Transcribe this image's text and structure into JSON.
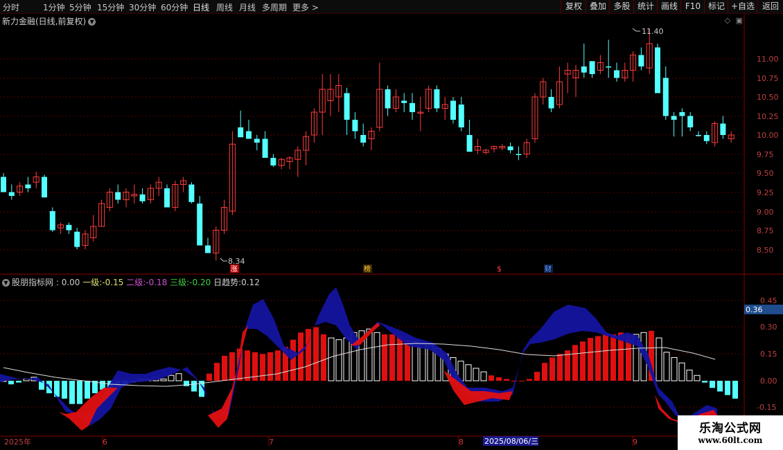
{
  "toolbar": {
    "tabs": [
      "分时",
      "1分钟",
      "5分钟",
      "15分钟",
      "30分钟",
      "60分钟",
      "日线",
      "周线",
      "月线",
      "多周期",
      "更多 >"
    ],
    "active_tab": "日线",
    "right_buttons": [
      "复权",
      "叠加",
      "多股",
      "统计",
      "画线",
      "F10",
      "标记",
      "+自选",
      "返回"
    ]
  },
  "price_panel": {
    "title": "新力金融(日线,前复权)",
    "high_marker": "11.40",
    "low_marker": "8.34",
    "event_markers": [
      "涨",
      "榜",
      "$",
      "财"
    ],
    "axis_ticks": [
      "11.00",
      "10.75",
      "10.50",
      "10.25",
      "10.00",
      "9.75",
      "9.50",
      "9.25",
      "9.00",
      "8.75",
      "8.50"
    ]
  },
  "indicator_panel": {
    "name": "股朋指标网",
    "main_value": ": 0.00",
    "items": [
      {
        "label": "一级:",
        "value": "-0.15",
        "color": "#e0e070"
      },
      {
        "label": "二级:",
        "value": "-0.18",
        "color": "#d050d0"
      },
      {
        "label": "三级:",
        "value": "-0.20",
        "color": "#40d040"
      },
      {
        "label": "日趋势:",
        "value": "0.12",
        "color": "#d0d0d0"
      }
    ],
    "axis_ticks": [
      "0.45",
      "0.30",
      "0.15",
      "0.00",
      "-0.15"
    ],
    "current_value": "0.36"
  },
  "date_axis": {
    "labels": [
      "2025年",
      "6",
      "7",
      "8",
      "9"
    ],
    "highlight": "2025/08/06/三"
  },
  "watermark": {
    "line1": "乐淘公式网",
    "line2": "www.60lt.com"
  },
  "colors": {
    "up": "#ff3c3c",
    "down": "#54ffff",
    "grid": "#5a0000",
    "blue": "#1414a0",
    "red": "#e01010"
  }
}
